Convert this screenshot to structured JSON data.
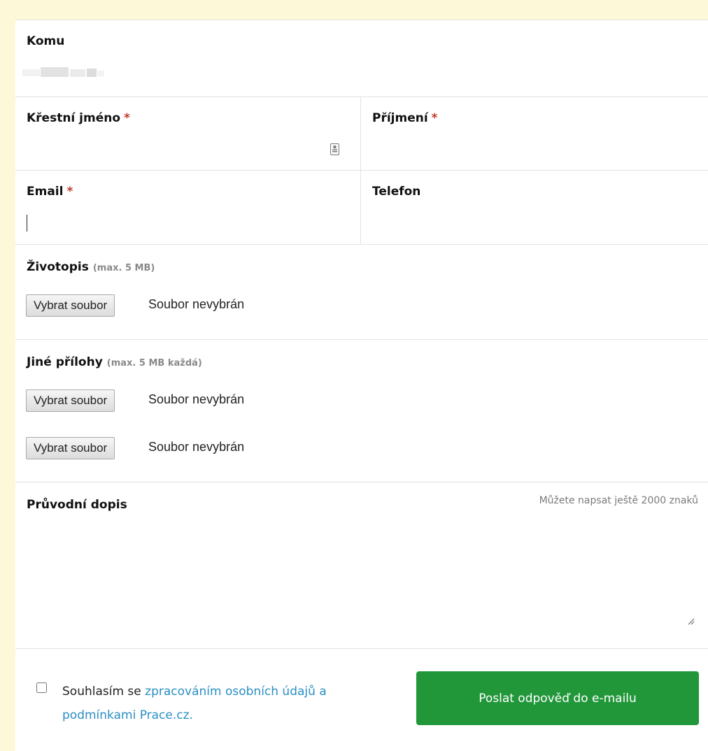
{
  "form": {
    "komu": {
      "label": "Komu"
    },
    "first_name": {
      "label": "Křestní jméno",
      "required_mark": "*",
      "value": ""
    },
    "last_name": {
      "label": "Příjmení",
      "required_mark": "*",
      "value": ""
    },
    "email": {
      "label": "Email",
      "required_mark": "*",
      "value": ""
    },
    "phone": {
      "label": "Telefon",
      "value": ""
    },
    "cv": {
      "label": "Životopis",
      "hint": "(max. 5 MB)",
      "button": "Vybrat soubor",
      "status": "Soubor nevybrán"
    },
    "attachments": {
      "label": "Jiné přílohy",
      "hint": "(max. 5 MB každá)",
      "items": [
        {
          "button": "Vybrat soubor",
          "status": "Soubor nevybrán"
        },
        {
          "button": "Vybrat soubor",
          "status": "Soubor nevybrán"
        }
      ]
    },
    "cover_letter": {
      "label": "Průvodní dopis",
      "counter": "Můžete napsat ještě 2000 znaků",
      "value": ""
    },
    "consent": {
      "checked": false,
      "text_before": "Souhlasím se ",
      "link_text": "zpracováním osobních údajů a podmínkami Prace.cz."
    },
    "submit_label": "Poslat odpověď do e-mailu",
    "colors": {
      "submit": "#21973a",
      "required": "#c0392b",
      "link": "#2a8fc3",
      "page_bg": "#fdf9d8"
    },
    "icons": {
      "name_field_icon": "contact-card-icon",
      "resize_handle": "resize-grip-icon"
    }
  }
}
